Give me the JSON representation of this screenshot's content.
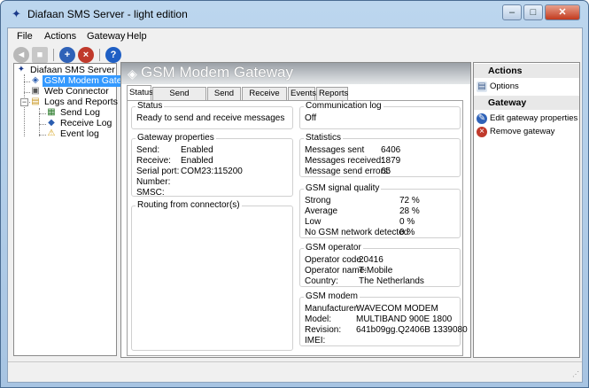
{
  "window": {
    "title": "Diafaan SMS Server - light edition",
    "minimize": "–",
    "maximize": "□",
    "close": "✕"
  },
  "menu": [
    {
      "label": "File"
    },
    {
      "label": "Actions"
    },
    {
      "label": "Gateway"
    },
    {
      "label": "Help"
    }
  ],
  "toolbar": {
    "back_icon": "back-icon",
    "forward_icon": "forward-icon",
    "add_gateway_icon": "add-gateway-icon",
    "remove_gateway_icon": "remove-gateway-icon",
    "help_icon": "help-icon",
    "help_glyph": "?"
  },
  "tree": {
    "root": "Diafaan SMS Server",
    "gateway": "GSM Modem Gateway",
    "connector": "Web Connector",
    "logs": "Logs and Reports",
    "send_log": "Send Log",
    "receive_log": "Receive Log",
    "event_log": "Event log"
  },
  "header": {
    "title": "GSM Modem Gateway"
  },
  "tabs": [
    {
      "label": "Status"
    },
    {
      "label": "Send Message"
    },
    {
      "label": "Send log"
    },
    {
      "label": "Receive log"
    },
    {
      "label": "Events"
    },
    {
      "label": "Reports"
    }
  ],
  "status": {
    "title": "Status",
    "text": "Ready to send and receive messages"
  },
  "gateway_props": {
    "title": "Gateway properties",
    "rows": [
      {
        "k": "Send:",
        "v": "Enabled"
      },
      {
        "k": "Receive:",
        "v": "Enabled"
      },
      {
        "k": "Serial port:",
        "v": "COM23:115200"
      },
      {
        "k": "Number:",
        "v": ""
      },
      {
        "k": "SMSC:",
        "v": ""
      }
    ]
  },
  "routing": {
    "title": "Routing from connector(s)"
  },
  "comm_log": {
    "title": "Communication log",
    "text": "Off"
  },
  "statistics": {
    "title": "Statistics",
    "rows": [
      {
        "k": "Messages sent",
        "v": "6406"
      },
      {
        "k": "Messages received:",
        "v": "1879"
      },
      {
        "k": "Message send errors:",
        "v": "65"
      }
    ]
  },
  "signal": {
    "title": "GSM signal quality",
    "rows": [
      {
        "k": "Strong",
        "v": "72 %"
      },
      {
        "k": "Average",
        "v": "28 %"
      },
      {
        "k": "Low",
        "v": "0 %"
      },
      {
        "k": "No GSM network detected",
        "v": "0 %"
      }
    ]
  },
  "operator": {
    "title": "GSM operator",
    "rows": [
      {
        "k": "Operator code:",
        "v": "20416"
      },
      {
        "k": "Operator name:",
        "v": "T-Mobile"
      },
      {
        "k": "Country:",
        "v": "The Netherlands"
      }
    ]
  },
  "modem": {
    "title": "GSM modem",
    "rows": [
      {
        "k": "Manufacturer:",
        "v": "WAVECOM MODEM"
      },
      {
        "k": "Model:",
        "v": "MULTIBAND  900E  1800"
      },
      {
        "k": "Revision:",
        "v": "641b09gg.Q2406B 1339080"
      },
      {
        "k": "IMEI:",
        "v": ""
      }
    ]
  },
  "actions": {
    "title": "Actions",
    "options": "Options",
    "gateway_title": "Gateway",
    "edit": "Edit gateway properties",
    "remove": "Remove gateway"
  },
  "colors": {
    "accent": "#3399ff",
    "header_gradient": "#9aa0a6",
    "window_frame": "#bcd6ee"
  }
}
